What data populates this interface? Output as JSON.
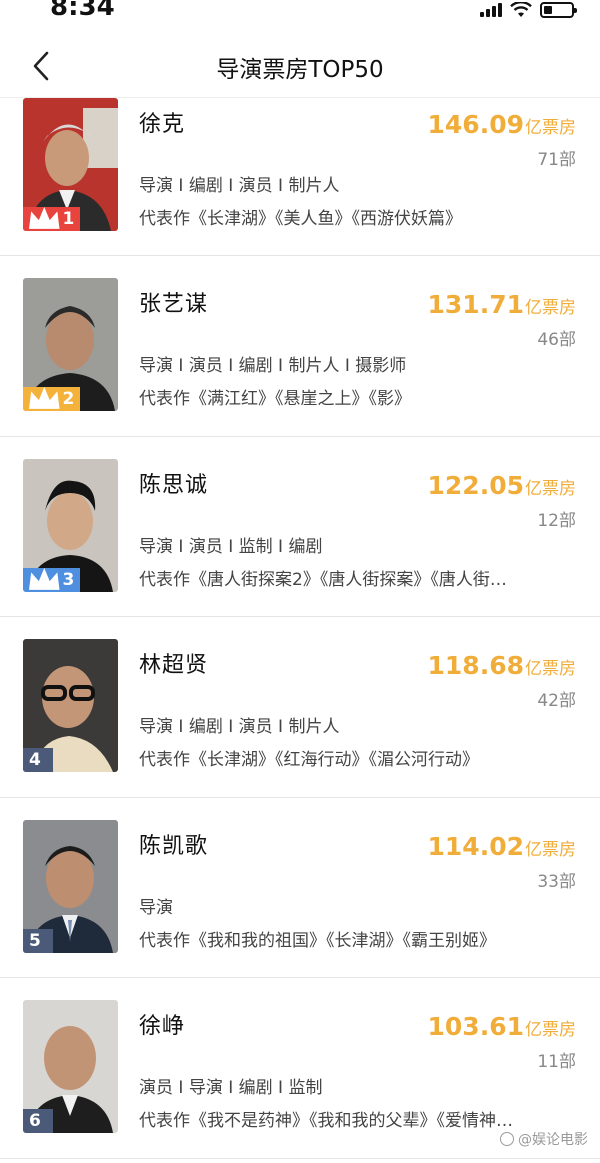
{
  "status_bar": {
    "time": "8:34"
  },
  "header": {
    "title": "导演票房TOP50"
  },
  "colors": {
    "accent": "#f1ad3a",
    "rank1": "#e8433d",
    "rank2": "#f4b23a",
    "rank3": "#4e8fe0",
    "rank_other": "#4a5a78"
  },
  "list": [
    {
      "rank": "1",
      "name": "徐克",
      "box_value": "146.09",
      "box_unit": "亿票房",
      "films": "71部",
      "roles": "导演 I 编剧 I 演员 I 制片人",
      "works": "代表作《长津湖》《美人鱼》《西游伏妖篇》"
    },
    {
      "rank": "2",
      "name": "张艺谋",
      "box_value": "131.71",
      "box_unit": "亿票房",
      "films": "46部",
      "roles": "导演 I 演员 I 编剧 I 制片人 I 摄影师",
      "works": "代表作《满江红》《悬崖之上》《影》"
    },
    {
      "rank": "3",
      "name": "陈思诚",
      "box_value": "122.05",
      "box_unit": "亿票房",
      "films": "12部",
      "roles": "导演 I 演员 I 监制 I 编剧",
      "works": "代表作《唐人街探案2》《唐人街探案》《唐人街…"
    },
    {
      "rank": "4",
      "name": "林超贤",
      "box_value": "118.68",
      "box_unit": "亿票房",
      "films": "42部",
      "roles": "导演 I 编剧 I 演员 I 制片人",
      "works": "代表作《长津湖》《红海行动》《湄公河行动》"
    },
    {
      "rank": "5",
      "name": "陈凯歌",
      "box_value": "114.02",
      "box_unit": "亿票房",
      "films": "33部",
      "roles": "导演",
      "works": "代表作《我和我的祖国》《长津湖》《霸王别姬》"
    },
    {
      "rank": "6",
      "name": "徐峥",
      "box_value": "103.61",
      "box_unit": "亿票房",
      "films": "11部",
      "roles": "演员 I 导演 I 编剧 I 监制",
      "works": "代表作《我不是药神》《我和我的父辈》《爱情神…"
    }
  ],
  "watermark": {
    "text": "@娱论电影"
  }
}
